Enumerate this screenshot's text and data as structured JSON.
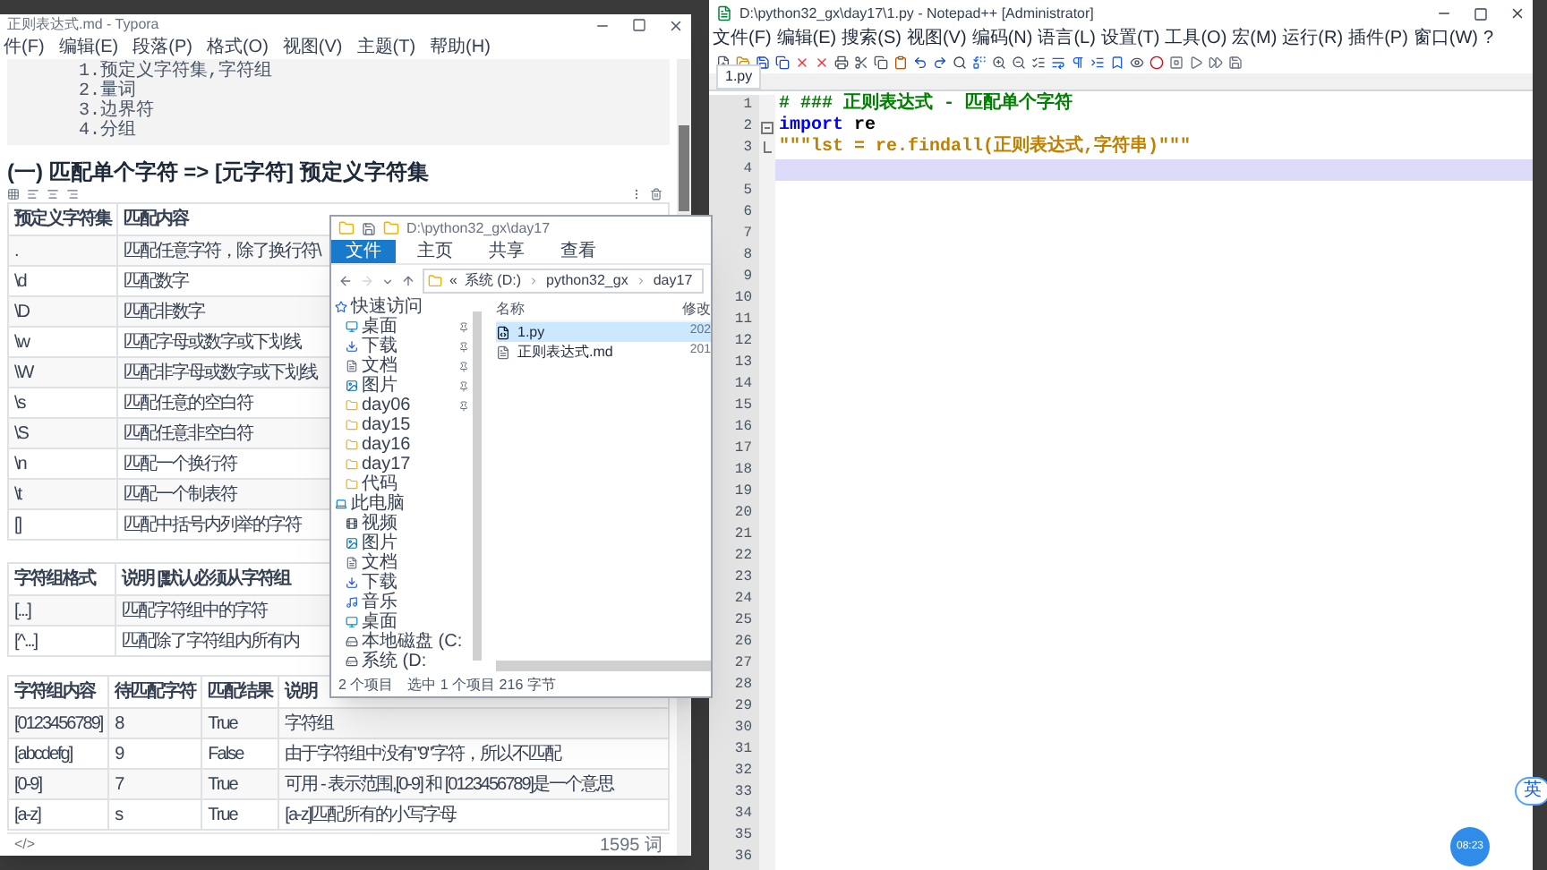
{
  "typora": {
    "title": "正则表达式.md - Typora",
    "menu": [
      "件(F)",
      "编辑(E)",
      "段落(P)",
      "格式(O)",
      "视图(V)",
      "主题(T)",
      "帮助(H)"
    ],
    "outline": [
      "1.预定义字符集,字符组",
      "2.量词",
      "3.边界符",
      "4.分组"
    ],
    "heading": "(一) 匹配单个字符 => [元字符] 预定义字符集",
    "table_1": {
      "columns": [
        "预定义字符集",
        "匹配内容"
      ],
      "rows": [
        [
          ".",
          "匹配任意字符，除了换行符\\"
        ],
        [
          "\\d",
          "匹配数字"
        ],
        [
          "\\D",
          "匹配非数字"
        ],
        [
          "\\w",
          "匹配字母或数字或下划线"
        ],
        [
          "\\W",
          "匹配非字母或数字或下划线"
        ],
        [
          "\\s",
          "匹配任意的空白符"
        ],
        [
          "\\S",
          "匹配任意非空白符"
        ],
        [
          "\\n",
          "匹配一个换行符"
        ],
        [
          "\\t",
          "匹配一个制表符"
        ],
        [
          "[]",
          "匹配中括号内列举的字符"
        ]
      ]
    },
    "table_2": {
      "columns": [
        "字符组格式",
        "说明 [默认必须从字符组"
      ],
      "rows": [
        [
          "[...]",
          "匹配字符组中的字符"
        ],
        [
          "[^...]",
          "匹配除了字符组内所有内"
        ]
      ]
    },
    "table_3": {
      "columns": [
        "字符组内容",
        "待匹配字符",
        "匹配结果",
        "说明"
      ],
      "rows": [
        [
          "[0123456789]",
          "8",
          "True",
          "字符组"
        ],
        [
          "[abcdefg]",
          "9",
          "False",
          "由于字符组中没有\"9\"字符，所以不匹配"
        ],
        [
          "[0-9]",
          "7",
          "True",
          "可用 - 表示范围,[0-9] 和 [0123456789]是一个意思"
        ],
        [
          "[a-z]",
          "s",
          "True",
          "[a-z]匹配所有的小写字母"
        ]
      ]
    },
    "status_left": "</>",
    "word_count": "1595 词"
  },
  "explorer": {
    "title": "D:\\python32_gx\\day17",
    "ribbon_tabs": [
      {
        "label": "文件",
        "selected": true
      },
      {
        "label": "主页",
        "selected": false
      },
      {
        "label": "共享",
        "selected": false
      },
      {
        "label": "查看",
        "selected": false
      }
    ],
    "address": [
      "«",
      "系统 (D:)",
      "python32_gx",
      "day17"
    ],
    "nav": [
      {
        "label": "快速访问",
        "kind": "star",
        "pinned": false
      },
      {
        "label": "桌面",
        "kind": "desktop",
        "pinned": true
      },
      {
        "label": "下载",
        "kind": "download",
        "pinned": true
      },
      {
        "label": "文档",
        "kind": "document",
        "pinned": true
      },
      {
        "label": "图片",
        "kind": "picture",
        "pinned": true
      },
      {
        "label": "day06",
        "kind": "folder",
        "pinned": true
      },
      {
        "label": "day15",
        "kind": "folder",
        "pinned": false
      },
      {
        "label": "day16",
        "kind": "folder",
        "pinned": false
      },
      {
        "label": "day17",
        "kind": "folder",
        "pinned": false
      },
      {
        "label": "代码",
        "kind": "folder",
        "pinned": false
      },
      {
        "label": "此电脑",
        "kind": "pc",
        "pinned": false
      },
      {
        "label": "视频",
        "kind": "video",
        "pinned": false
      },
      {
        "label": "图片",
        "kind": "picture",
        "pinned": false
      },
      {
        "label": "文档",
        "kind": "document",
        "pinned": false
      },
      {
        "label": "下载",
        "kind": "download",
        "pinned": false
      },
      {
        "label": "音乐",
        "kind": "music",
        "pinned": false
      },
      {
        "label": "桌面",
        "kind": "desktop",
        "pinned": false
      },
      {
        "label": "本地磁盘 (C:",
        "kind": "drive",
        "pinned": false
      },
      {
        "label": "系统 (D:",
        "kind": "drive",
        "pinned": false
      }
    ],
    "columns": [
      "名称",
      "修改"
    ],
    "files": [
      {
        "name": "1.py",
        "date": "202",
        "kind": "python",
        "selected": true
      },
      {
        "name": "正则表达式.md",
        "date": "201",
        "kind": "markdown",
        "selected": false
      }
    ],
    "status": [
      "2 个项目",
      "选中 1 个项目 216 字节"
    ]
  },
  "notepad": {
    "title": "D:\\python32_gx\\day17\\1.py - Notepad++ [Administrator]",
    "menu": [
      "文件(F)",
      "编辑(E)",
      "搜索(S)",
      "视图(V)",
      "编码(N)",
      "语言(L)",
      "设置(T)",
      "工具(O)",
      "宏(M)",
      "运行(R)",
      "插件(P)",
      "窗口(W)",
      "?"
    ],
    "tab": "1.py",
    "lines": [
      {
        "number": "1",
        "current": false,
        "kind": "plain",
        "tokens": [
          {
            "text": "# ### 正则表达式 - 匹配单个字符",
            "kind": "comment"
          }
        ]
      },
      {
        "number": "2",
        "current": false,
        "kind": "fold_start",
        "tokens": [
          {
            "text": "import",
            "kind": "keyword"
          },
          {
            "text": " re",
            "kind": "plain"
          }
        ]
      },
      {
        "number": "3",
        "current": false,
        "kind": "fold_end",
        "tokens": [
          {
            "text": "\"\"\"lst = re.findall(正则表达式,字符串)\"\"\"",
            "kind": "string"
          }
        ]
      },
      {
        "number": "4",
        "current": true,
        "kind": "plain"
      },
      {
        "number": "5",
        "current": false,
        "kind": "plain"
      },
      {
        "number": "6",
        "current": false,
        "kind": "plain"
      },
      {
        "number": "7",
        "current": false,
        "kind": "plain"
      },
      {
        "number": "8",
        "current": false,
        "kind": "plain"
      },
      {
        "number": "9",
        "current": false,
        "kind": "plain"
      },
      {
        "number": "10",
        "current": false,
        "kind": "plain"
      },
      {
        "number": "11",
        "current": false,
        "kind": "plain"
      },
      {
        "number": "12",
        "current": false,
        "kind": "plain"
      },
      {
        "number": "13",
        "current": false,
        "kind": "plain"
      },
      {
        "number": "14",
        "current": false,
        "kind": "plain"
      },
      {
        "number": "15",
        "current": false,
        "kind": "plain"
      },
      {
        "number": "16",
        "current": false,
        "kind": "plain"
      },
      {
        "number": "17",
        "current": false,
        "kind": "plain"
      },
      {
        "number": "18",
        "current": false,
        "kind": "plain"
      },
      {
        "number": "19",
        "current": false,
        "kind": "plain"
      },
      {
        "number": "20",
        "current": false,
        "kind": "plain"
      },
      {
        "number": "21",
        "current": false,
        "kind": "plain"
      },
      {
        "number": "22",
        "current": false,
        "kind": "plain"
      },
      {
        "number": "23",
        "current": false,
        "kind": "plain"
      },
      {
        "number": "24",
        "current": false,
        "kind": "plain"
      },
      {
        "number": "25",
        "current": false,
        "kind": "plain"
      },
      {
        "number": "26",
        "current": false,
        "kind": "plain"
      },
      {
        "number": "27",
        "current": false,
        "kind": "plain"
      },
      {
        "number": "28",
        "current": false,
        "kind": "plain"
      },
      {
        "number": "29",
        "current": false,
        "kind": "plain"
      },
      {
        "number": "30",
        "current": false,
        "kind": "plain"
      },
      {
        "number": "31",
        "current": false,
        "kind": "plain"
      },
      {
        "number": "32",
        "current": false,
        "kind": "plain"
      },
      {
        "number": "33",
        "current": false,
        "kind": "plain"
      },
      {
        "number": "34",
        "current": false,
        "kind": "plain"
      },
      {
        "number": "35",
        "current": false,
        "kind": "plain"
      },
      {
        "number": "36",
        "current": false,
        "kind": "plain"
      }
    ]
  },
  "overlay": {
    "ime": "英",
    "timer": "08:23"
  }
}
